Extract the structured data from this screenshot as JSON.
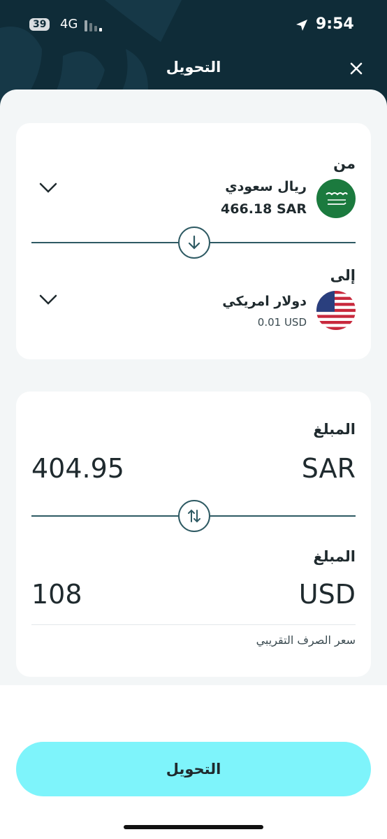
{
  "status_bar": {
    "battery": "39",
    "network": "4G",
    "time": "9:54"
  },
  "header": {
    "title": "التحويل",
    "close_icon": "close-icon"
  },
  "from_section": {
    "label": "من",
    "currency_name": "ريال سعودي",
    "balance": "466.18  SAR",
    "flag": "saudi-flag"
  },
  "to_section": {
    "label": "إلى",
    "currency_name": "دولار امريكي",
    "balance": "0.01  USD",
    "flag": "us-flag"
  },
  "amount_from": {
    "label": "المبلغ",
    "currency": "SAR",
    "value": "404.95"
  },
  "amount_to": {
    "label": "المبلغ",
    "currency": "USD",
    "value": "108"
  },
  "rate_label": "سعر الصرف التقريبي",
  "primary_button": "التحويل",
  "colors": {
    "header_bg": "#0f2c38",
    "accent_line": "#2e5a63",
    "button_bg": "#7ef4fb",
    "sheet_bg": "#f3f6f7"
  }
}
